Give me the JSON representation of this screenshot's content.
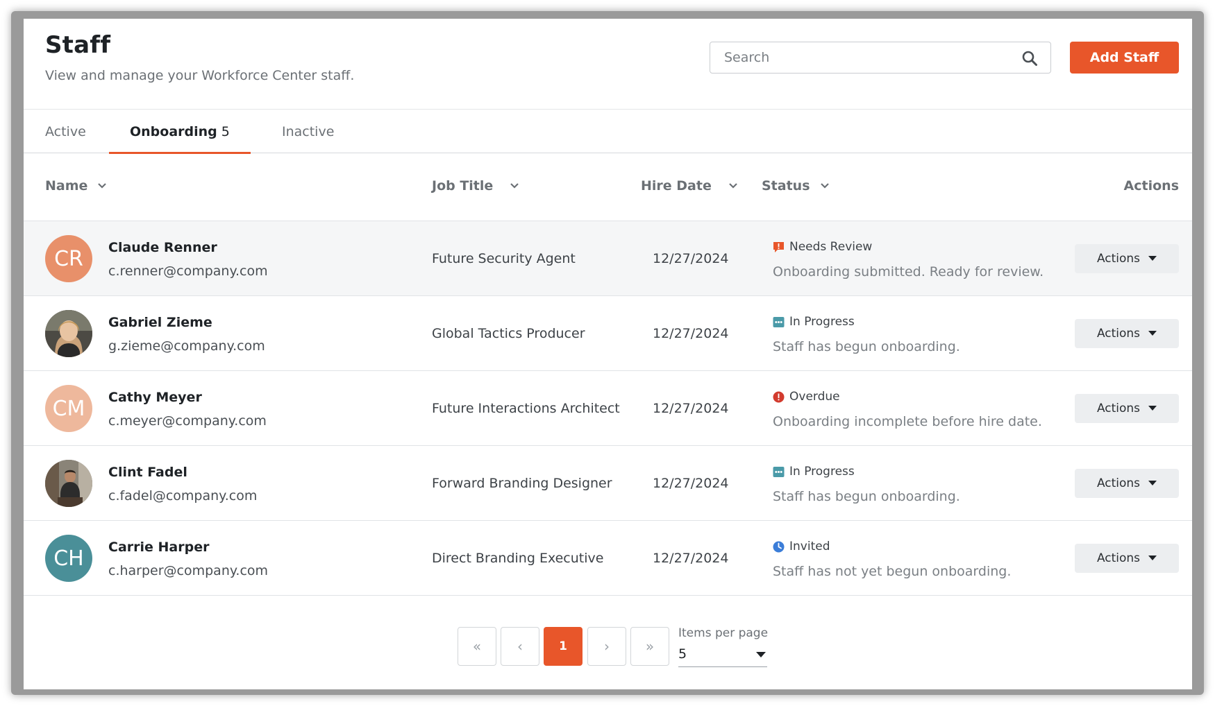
{
  "header": {
    "title": "Staff",
    "subtitle": "View and manage your Workforce Center staff.",
    "search_placeholder": "Search",
    "add_button": "Add Staff"
  },
  "tabs": [
    {
      "label": "Active",
      "count": ""
    },
    {
      "label": "Onboarding",
      "count": "5"
    },
    {
      "label": "Inactive",
      "count": ""
    }
  ],
  "columns": {
    "name": "Name",
    "job_title": "Job Title",
    "hire_date": "Hire Date",
    "status": "Status",
    "actions": "Actions"
  },
  "rows": [
    {
      "initials": "CR",
      "avatar_color": "#e8906a",
      "avatar_type": "initials",
      "name": "Claude Renner",
      "email": "c.renner@company.com",
      "job_title": "Future Security Agent",
      "hire_date": "12/27/2024",
      "status": "Needs Review",
      "status_icon": "review-flag-icon",
      "status_color": "#e8562a",
      "status_desc": "Onboarding submitted. Ready for review.",
      "action_label": "Actions"
    },
    {
      "initials": "",
      "avatar_color": "#8a7a6a",
      "avatar_type": "photo",
      "name": "Gabriel Zieme",
      "email": "g.zieme@company.com",
      "job_title": "Global Tactics Producer",
      "hire_date": "12/27/2024",
      "status": "In Progress",
      "status_icon": "ellipsis-chat-icon",
      "status_color": "#4a9aa8",
      "status_desc": "Staff has begun onboarding.",
      "action_label": "Actions"
    },
    {
      "initials": "CM",
      "avatar_color": "#eeb89c",
      "avatar_type": "initials",
      "name": "Cathy Meyer",
      "email": "c.meyer@company.com",
      "job_title": "Future Interactions Architect",
      "hire_date": "12/27/2024",
      "status": "Overdue",
      "status_icon": "alert-circle-icon",
      "status_color": "#d23b2e",
      "status_desc": "Onboarding incomplete before hire date.",
      "action_label": "Actions"
    },
    {
      "initials": "",
      "avatar_color": "#5a5048",
      "avatar_type": "photo",
      "name": "Clint Fadel",
      "email": "c.fadel@company.com",
      "job_title": "Forward Branding Designer",
      "hire_date": "12/27/2024",
      "status": "In Progress",
      "status_icon": "ellipsis-chat-icon",
      "status_color": "#4a9aa8",
      "status_desc": "Staff has begun onboarding.",
      "action_label": "Actions"
    },
    {
      "initials": "CH",
      "avatar_color": "#4a8f98",
      "avatar_type": "initials",
      "name": "Carrie Harper",
      "email": "c.harper@company.com",
      "job_title": "Direct Branding Executive",
      "hire_date": "12/27/2024",
      "status": "Invited",
      "status_icon": "clock-icon",
      "status_color": "#3b7dd8",
      "status_desc": "Staff has not yet begun onboarding.",
      "action_label": "Actions"
    }
  ],
  "pagination": {
    "first": "«",
    "prev": "‹",
    "current_page": "1",
    "next": "›",
    "last": "»",
    "items_per_page_label": "Items per page",
    "items_per_page_value": "5"
  },
  "colors": {
    "accent": "#e8562a",
    "muted_text": "#6b7075"
  }
}
